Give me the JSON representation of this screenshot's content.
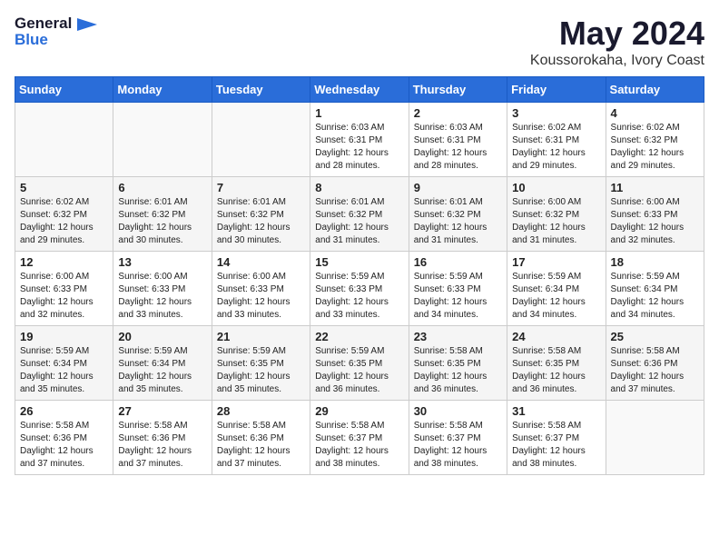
{
  "logo": {
    "line1": "General",
    "line2": "Blue"
  },
  "title": "May 2024",
  "subtitle": "Koussorokaha, Ivory Coast",
  "weekdays": [
    "Sunday",
    "Monday",
    "Tuesday",
    "Wednesday",
    "Thursday",
    "Friday",
    "Saturday"
  ],
  "weeks": [
    [
      {
        "day": "",
        "sunrise": "",
        "sunset": "",
        "daylight": ""
      },
      {
        "day": "",
        "sunrise": "",
        "sunset": "",
        "daylight": ""
      },
      {
        "day": "",
        "sunrise": "",
        "sunset": "",
        "daylight": ""
      },
      {
        "day": "1",
        "sunrise": "Sunrise: 6:03 AM",
        "sunset": "Sunset: 6:31 PM",
        "daylight": "Daylight: 12 hours and 28 minutes."
      },
      {
        "day": "2",
        "sunrise": "Sunrise: 6:03 AM",
        "sunset": "Sunset: 6:31 PM",
        "daylight": "Daylight: 12 hours and 28 minutes."
      },
      {
        "day": "3",
        "sunrise": "Sunrise: 6:02 AM",
        "sunset": "Sunset: 6:31 PM",
        "daylight": "Daylight: 12 hours and 29 minutes."
      },
      {
        "day": "4",
        "sunrise": "Sunrise: 6:02 AM",
        "sunset": "Sunset: 6:32 PM",
        "daylight": "Daylight: 12 hours and 29 minutes."
      }
    ],
    [
      {
        "day": "5",
        "sunrise": "Sunrise: 6:02 AM",
        "sunset": "Sunset: 6:32 PM",
        "daylight": "Daylight: 12 hours and 29 minutes."
      },
      {
        "day": "6",
        "sunrise": "Sunrise: 6:01 AM",
        "sunset": "Sunset: 6:32 PM",
        "daylight": "Daylight: 12 hours and 30 minutes."
      },
      {
        "day": "7",
        "sunrise": "Sunrise: 6:01 AM",
        "sunset": "Sunset: 6:32 PM",
        "daylight": "Daylight: 12 hours and 30 minutes."
      },
      {
        "day": "8",
        "sunrise": "Sunrise: 6:01 AM",
        "sunset": "Sunset: 6:32 PM",
        "daylight": "Daylight: 12 hours and 31 minutes."
      },
      {
        "day": "9",
        "sunrise": "Sunrise: 6:01 AM",
        "sunset": "Sunset: 6:32 PM",
        "daylight": "Daylight: 12 hours and 31 minutes."
      },
      {
        "day": "10",
        "sunrise": "Sunrise: 6:00 AM",
        "sunset": "Sunset: 6:32 PM",
        "daylight": "Daylight: 12 hours and 31 minutes."
      },
      {
        "day": "11",
        "sunrise": "Sunrise: 6:00 AM",
        "sunset": "Sunset: 6:33 PM",
        "daylight": "Daylight: 12 hours and 32 minutes."
      }
    ],
    [
      {
        "day": "12",
        "sunrise": "Sunrise: 6:00 AM",
        "sunset": "Sunset: 6:33 PM",
        "daylight": "Daylight: 12 hours and 32 minutes."
      },
      {
        "day": "13",
        "sunrise": "Sunrise: 6:00 AM",
        "sunset": "Sunset: 6:33 PM",
        "daylight": "Daylight: 12 hours and 33 minutes."
      },
      {
        "day": "14",
        "sunrise": "Sunrise: 6:00 AM",
        "sunset": "Sunset: 6:33 PM",
        "daylight": "Daylight: 12 hours and 33 minutes."
      },
      {
        "day": "15",
        "sunrise": "Sunrise: 5:59 AM",
        "sunset": "Sunset: 6:33 PM",
        "daylight": "Daylight: 12 hours and 33 minutes."
      },
      {
        "day": "16",
        "sunrise": "Sunrise: 5:59 AM",
        "sunset": "Sunset: 6:33 PM",
        "daylight": "Daylight: 12 hours and 34 minutes."
      },
      {
        "day": "17",
        "sunrise": "Sunrise: 5:59 AM",
        "sunset": "Sunset: 6:34 PM",
        "daylight": "Daylight: 12 hours and 34 minutes."
      },
      {
        "day": "18",
        "sunrise": "Sunrise: 5:59 AM",
        "sunset": "Sunset: 6:34 PM",
        "daylight": "Daylight: 12 hours and 34 minutes."
      }
    ],
    [
      {
        "day": "19",
        "sunrise": "Sunrise: 5:59 AM",
        "sunset": "Sunset: 6:34 PM",
        "daylight": "Daylight: 12 hours and 35 minutes."
      },
      {
        "day": "20",
        "sunrise": "Sunrise: 5:59 AM",
        "sunset": "Sunset: 6:34 PM",
        "daylight": "Daylight: 12 hours and 35 minutes."
      },
      {
        "day": "21",
        "sunrise": "Sunrise: 5:59 AM",
        "sunset": "Sunset: 6:35 PM",
        "daylight": "Daylight: 12 hours and 35 minutes."
      },
      {
        "day": "22",
        "sunrise": "Sunrise: 5:59 AM",
        "sunset": "Sunset: 6:35 PM",
        "daylight": "Daylight: 12 hours and 36 minutes."
      },
      {
        "day": "23",
        "sunrise": "Sunrise: 5:58 AM",
        "sunset": "Sunset: 6:35 PM",
        "daylight": "Daylight: 12 hours and 36 minutes."
      },
      {
        "day": "24",
        "sunrise": "Sunrise: 5:58 AM",
        "sunset": "Sunset: 6:35 PM",
        "daylight": "Daylight: 12 hours and 36 minutes."
      },
      {
        "day": "25",
        "sunrise": "Sunrise: 5:58 AM",
        "sunset": "Sunset: 6:36 PM",
        "daylight": "Daylight: 12 hours and 37 minutes."
      }
    ],
    [
      {
        "day": "26",
        "sunrise": "Sunrise: 5:58 AM",
        "sunset": "Sunset: 6:36 PM",
        "daylight": "Daylight: 12 hours and 37 minutes."
      },
      {
        "day": "27",
        "sunrise": "Sunrise: 5:58 AM",
        "sunset": "Sunset: 6:36 PM",
        "daylight": "Daylight: 12 hours and 37 minutes."
      },
      {
        "day": "28",
        "sunrise": "Sunrise: 5:58 AM",
        "sunset": "Sunset: 6:36 PM",
        "daylight": "Daylight: 12 hours and 37 minutes."
      },
      {
        "day": "29",
        "sunrise": "Sunrise: 5:58 AM",
        "sunset": "Sunset: 6:37 PM",
        "daylight": "Daylight: 12 hours and 38 minutes."
      },
      {
        "day": "30",
        "sunrise": "Sunrise: 5:58 AM",
        "sunset": "Sunset: 6:37 PM",
        "daylight": "Daylight: 12 hours and 38 minutes."
      },
      {
        "day": "31",
        "sunrise": "Sunrise: 5:58 AM",
        "sunset": "Sunset: 6:37 PM",
        "daylight": "Daylight: 12 hours and 38 minutes."
      },
      {
        "day": "",
        "sunrise": "",
        "sunset": "",
        "daylight": ""
      }
    ]
  ]
}
